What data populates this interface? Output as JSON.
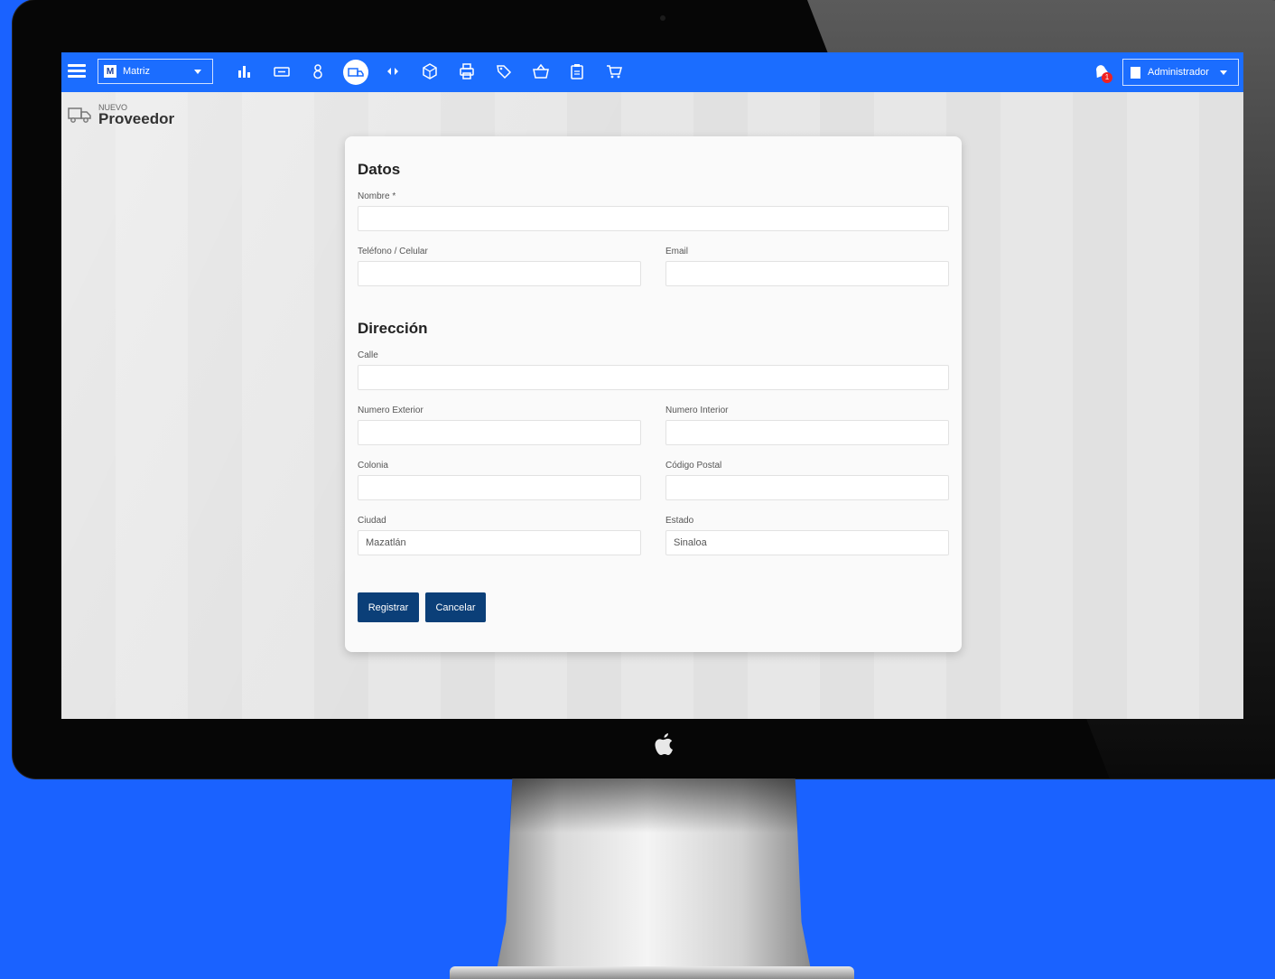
{
  "topbar": {
    "branch_badge": "M",
    "branch_select": "Matriz",
    "icons": [
      "menu-icon",
      "bar-chart-icon",
      "ticket-icon",
      "user-icon",
      "shipping-icon",
      "transfer-icon",
      "box-icon",
      "printer-icon",
      "tag-icon",
      "basket-icon",
      "clipboard-icon",
      "cart-icon",
      "bell-icon"
    ],
    "notification_count": "1",
    "user_menu": "Administrador"
  },
  "breadcrumb": {
    "small": "NUEVO",
    "title": "Proveedor"
  },
  "form": {
    "datos": {
      "title": "Datos",
      "nombre_label": "Nombre *",
      "nombre_value": "",
      "telefono_label": "Teléfono / Celular",
      "telefono_value": "",
      "email_label": "Email",
      "email_value": ""
    },
    "direccion": {
      "title": "Dirección",
      "calle_label": "Calle",
      "calle_value": "",
      "num_ext_label": "Numero Exterior",
      "num_ext_value": "",
      "num_int_label": "Numero Interior",
      "num_int_value": "",
      "colonia_label": "Colonia",
      "colonia_value": "",
      "cp_label": "Código Postal",
      "cp_value": "",
      "ciudad_label": "Ciudad",
      "ciudad_value": "Mazatlán",
      "estado_label": "Estado",
      "estado_value": "Sinaloa"
    },
    "buttons": {
      "register": "Registrar",
      "cancel": "Cancelar"
    }
  },
  "colors": {
    "page_bg": "#1a62ff",
    "topbar": "#1b6dff",
    "primary_button": "#0b3f78"
  }
}
